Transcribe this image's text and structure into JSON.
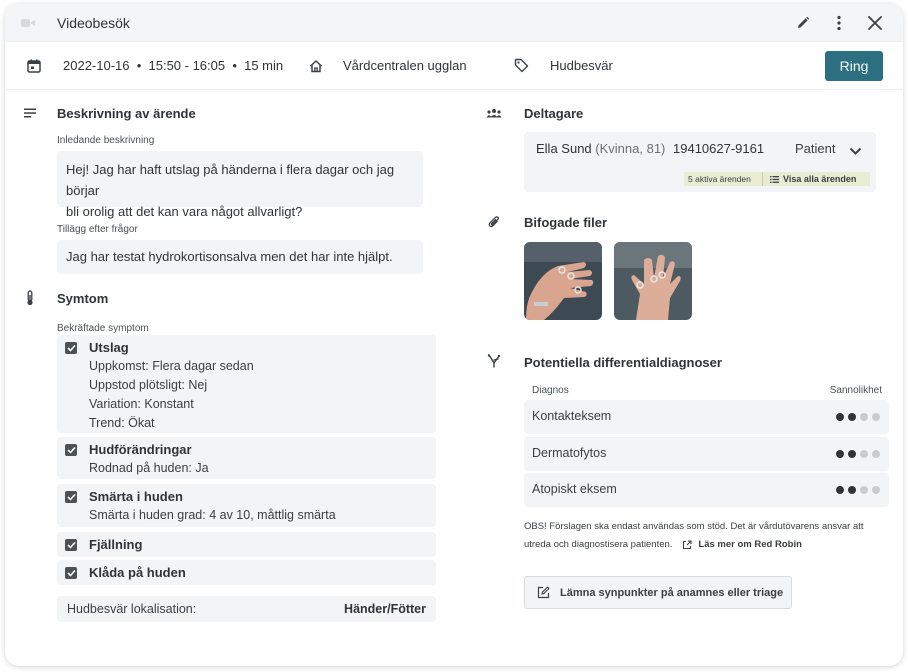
{
  "window": {
    "title": "Videobesök"
  },
  "info": {
    "datetime": "2022-10-16  •  15:50 - 16:05  •  15 min",
    "clinic": "Vårdcentralen ugglan",
    "category": "Hudbesvär",
    "call_label": "Ring"
  },
  "description": {
    "heading": "Beskrivning av ärende",
    "initial_label": "Inledande beskrivning",
    "initial_line1": "Hej! Jag har haft utslag på händerna i flera dagar och jag börjar",
    "initial_line2": "bli orolig att det kan vara något allvarligt?",
    "followup_label": "Tillägg efter frågor",
    "followup_text": "Jag har testat hydrokortisonsalva men det har inte hjälpt."
  },
  "symptoms": {
    "heading": "Symtom",
    "confirmed_label": "Bekräftade symptom",
    "items": [
      {
        "title": "Utslag",
        "details": [
          "Uppkomst: Flera dagar sedan",
          "Uppstod plötsligt: Nej",
          "Variation: Konstant",
          "Trend: Ökat"
        ]
      },
      {
        "title": "Hudförändringar",
        "details": [
          "Rodnad på huden: Ja"
        ]
      },
      {
        "title": "Smärta i huden",
        "details": [
          "Smärta i huden grad: 4 av 10, måttlig smärta"
        ]
      },
      {
        "title": "Fjällning",
        "details": []
      },
      {
        "title": "Klåda på huden",
        "details": []
      }
    ],
    "location_label": "Hudbesvär lokalisation:",
    "location_value": "Händer/Fötter"
  },
  "participants": {
    "heading": "Deltagare",
    "name": "Ella Sund",
    "meta": "(Kvinna, 81)",
    "personal_number": "19410627-9161",
    "role": "Patient",
    "active_cases": "5 aktiva ärenden",
    "show_all": "Visa alla ärenden"
  },
  "attachments": {
    "heading": "Bifogade filer"
  },
  "differential": {
    "heading": "Potentiella differentialdiagnoser",
    "col_diagnosis": "Diagnos",
    "col_probability": "Sannolikhet",
    "rows": [
      {
        "name": "Kontakteksem",
        "level": 2,
        "max": 4
      },
      {
        "name": "Dermatofytos",
        "level": 2,
        "max": 4
      },
      {
        "name": "Atopiskt eksem",
        "level": 2,
        "max": 4
      }
    ],
    "disclaimer_line1": "OBS! Förslagen ska endast användas som stöd. Det är vårdutövarens ansvar att",
    "disclaimer_line2": "utreda och diagnostisera patienten.",
    "read_more": "Läs mer om Red Robin"
  },
  "feedback": {
    "label": "Lämna synpunkter på anamnes eller triage"
  },
  "colors": {
    "accent": "#2b6f80",
    "badge": "#e8ecd2",
    "dot_on": "#2f3437",
    "dot_off": "#c9cccf"
  }
}
